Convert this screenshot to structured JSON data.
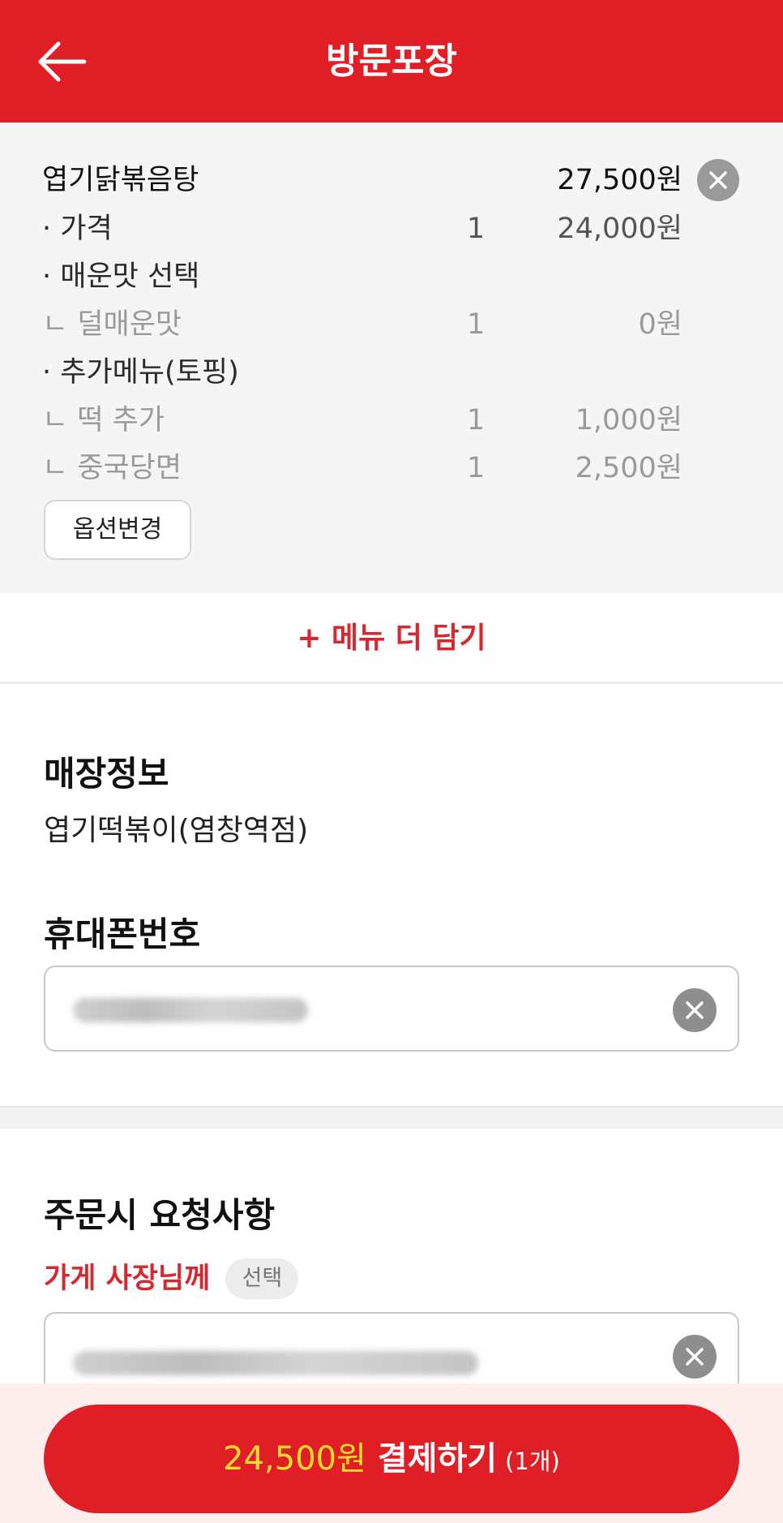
{
  "header": {
    "title": "방문포장"
  },
  "cart": {
    "item_name": "엽기닭볶음탕",
    "item_total": "27,500원",
    "lines": [
      {
        "name": "· 가격",
        "qty": "1",
        "price": "24,000원"
      },
      {
        "name": "· 매운맛 선택",
        "qty": "",
        "price": ""
      },
      {
        "name": "ㄴ 덜매운맛",
        "qty": "1",
        "price": "0원"
      },
      {
        "name": "· 추가메뉴(토핑)",
        "qty": "",
        "price": ""
      },
      {
        "name": "ㄴ 떡 추가",
        "qty": "1",
        "price": "1,000원"
      },
      {
        "name": "ㄴ 중국당면",
        "qty": "1",
        "price": "2,500원"
      }
    ],
    "option_change_label": "옵션변경"
  },
  "add_more": {
    "label": "+ 메뉴 더 담기"
  },
  "store": {
    "title": "매장정보",
    "name": "엽기떡볶이(염창역점)"
  },
  "phone": {
    "title": "휴대폰번호"
  },
  "request": {
    "title": "주문시 요청사항",
    "to_owner_label": "가게 사장님께",
    "chip_label": "선택"
  },
  "payment": {
    "amount": "24,500원",
    "label": "결제하기",
    "count": "(1개)"
  },
  "colors": {
    "brand_red": "#e01e26",
    "accent_red_text": "#d6282f",
    "amount_yellow": "#ffde2b"
  },
  "icons": {
    "back": "arrow-left-icon",
    "remove": "close-circle-icon",
    "clear": "close-circle-icon"
  }
}
